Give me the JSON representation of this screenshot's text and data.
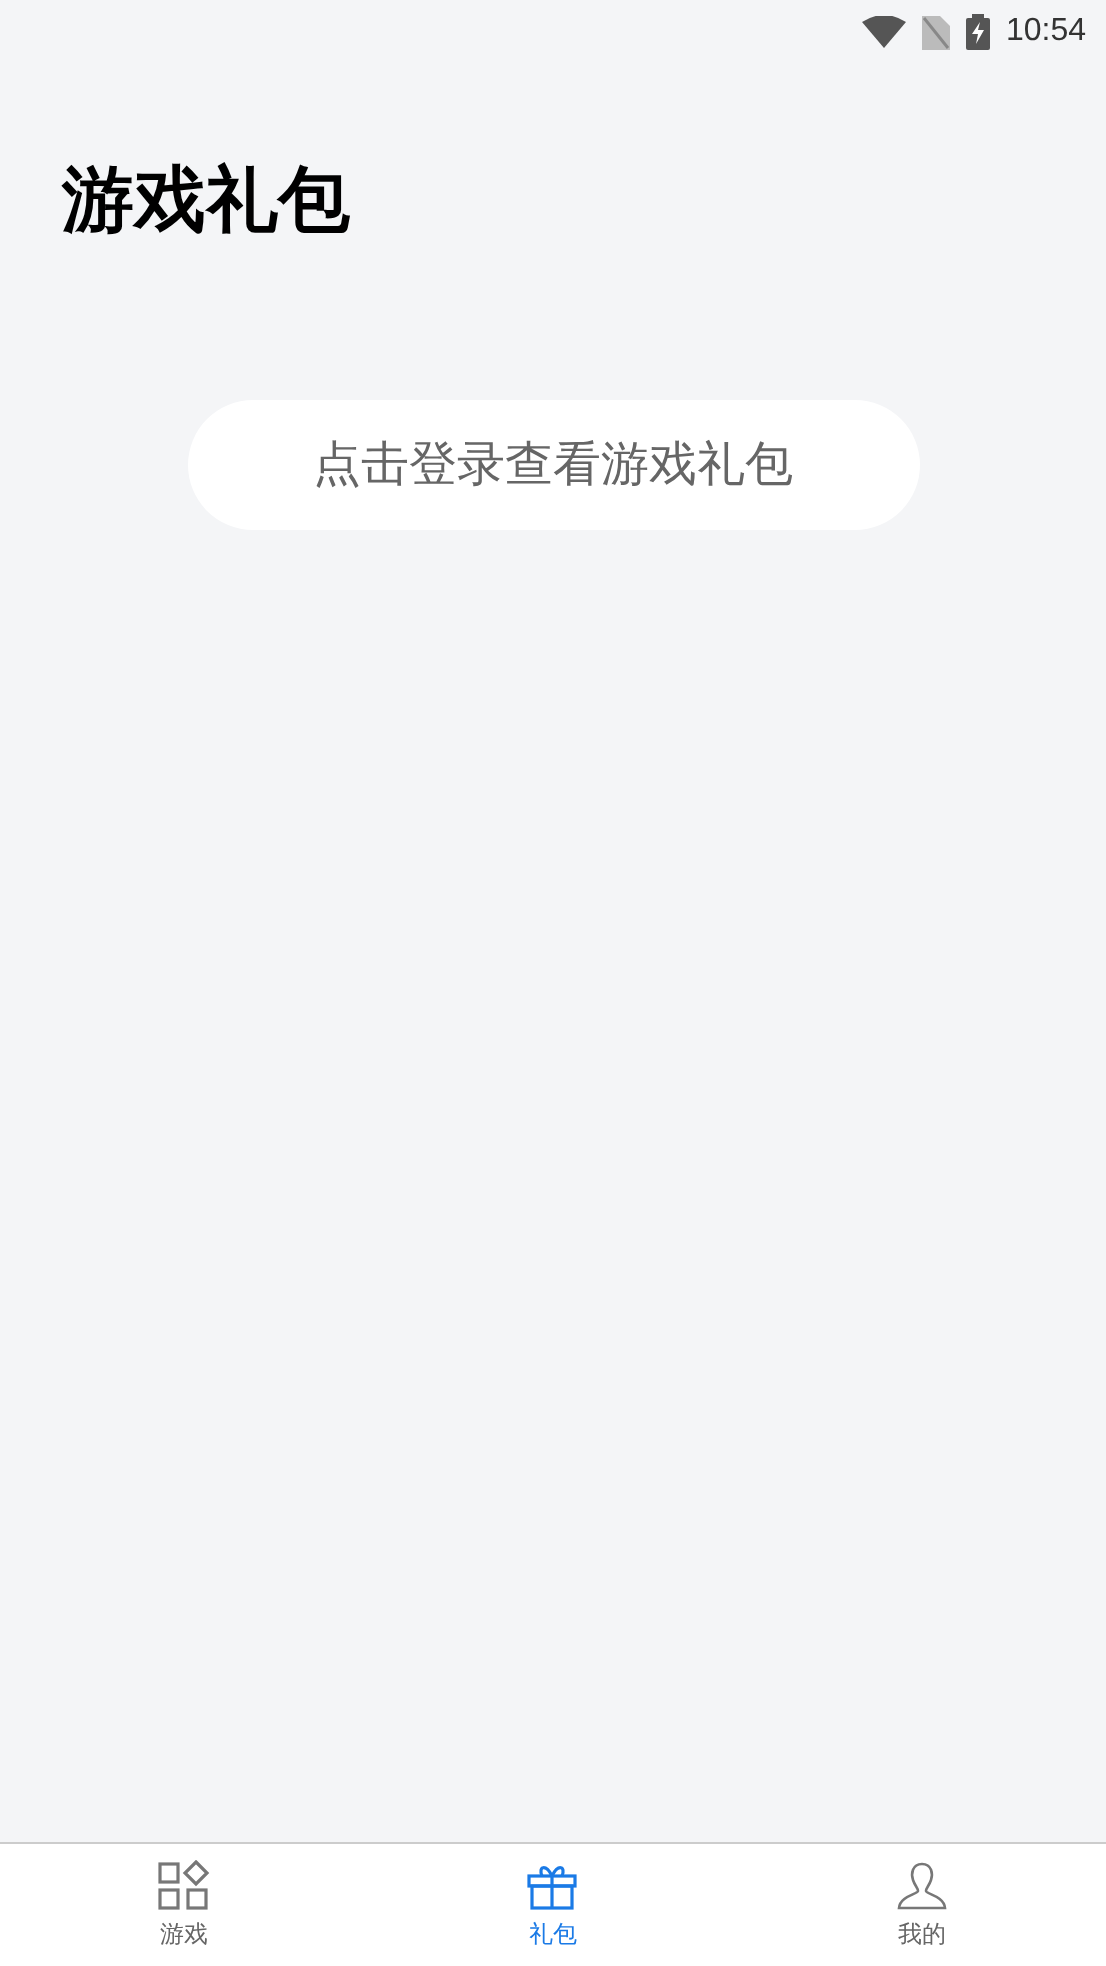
{
  "status_bar": {
    "time": "10:54"
  },
  "title": "游戏礼包",
  "login_button": "点击登录查看游戏礼包",
  "tabs": [
    {
      "kind": "games",
      "label": "游戏",
      "selected": false
    },
    {
      "kind": "gifts",
      "label": "礼包",
      "selected": true
    },
    {
      "kind": "profile",
      "label": "我的",
      "selected": false
    }
  ]
}
